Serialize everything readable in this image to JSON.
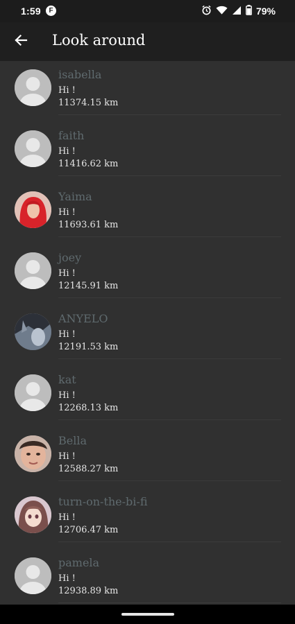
{
  "status_bar": {
    "time": "1:59",
    "app_badge": "F",
    "battery": "79%",
    "icons": [
      "alarm-icon",
      "wifi-icon",
      "signal-icon",
      "battery-icon"
    ]
  },
  "app_bar": {
    "title": "Look around",
    "back_icon": "arrow-left-icon"
  },
  "users": [
    {
      "name": "isabella",
      "message": "Hi !",
      "distance": "11374.15 km",
      "avatar": "default"
    },
    {
      "name": "faith",
      "message": "Hi !",
      "distance": "11416.62 km",
      "avatar": "default"
    },
    {
      "name": "Yaima",
      "message": "Hi !",
      "distance": "11693.61 km",
      "avatar": "photo-red-hair"
    },
    {
      "name": "joey",
      "message": "Hi !",
      "distance": "12145.91 km",
      "avatar": "default"
    },
    {
      "name": "ANYELO",
      "message": "Hi !",
      "distance": "12191.53 km",
      "avatar": "photo-dark"
    },
    {
      "name": "kat",
      "message": "Hi !",
      "distance": "12268.13 km",
      "avatar": "default"
    },
    {
      "name": "Bella",
      "message": "Hi !",
      "distance": "12588.27 km",
      "avatar": "photo-face"
    },
    {
      "name": "turn-on-the-bi-fi",
      "message": "Hi !",
      "distance": "12706.47 km",
      "avatar": "photo-anime"
    },
    {
      "name": "pamela",
      "message": "Hi !",
      "distance": "12938.89 km",
      "avatar": "default"
    }
  ],
  "colors": {
    "background": "#303030",
    "app_bar": "#1f1f1f",
    "name_text": "#5f6a6e",
    "body_text": "#e6e6e6",
    "avatar_default": "#bdbdbd"
  }
}
